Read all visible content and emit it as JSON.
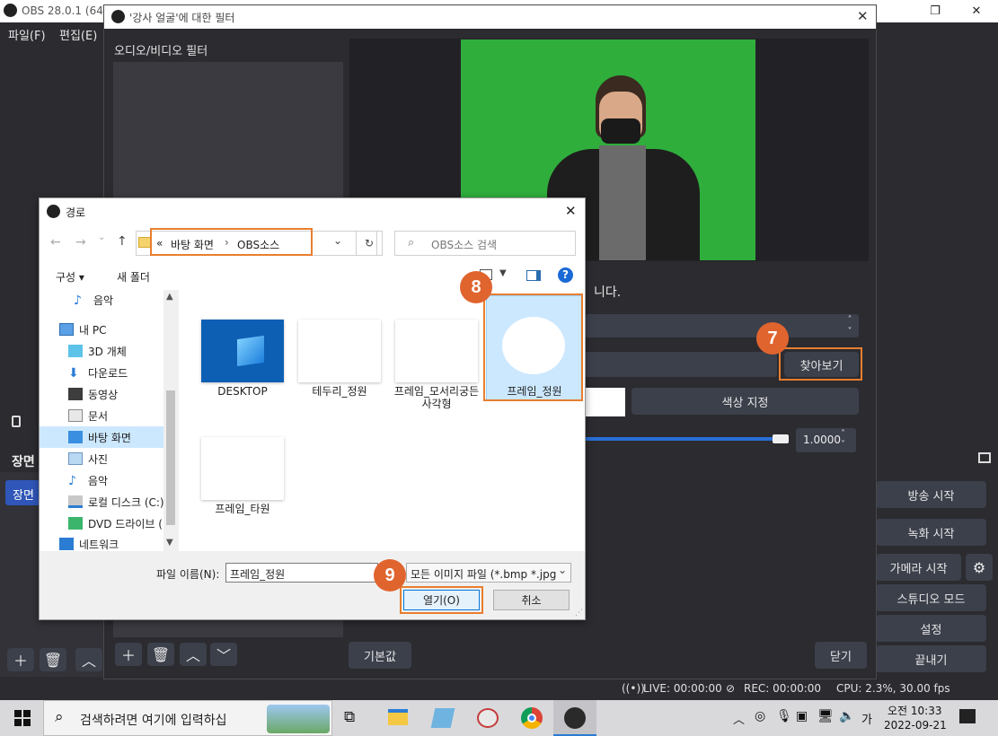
{
  "obs": {
    "title": "OBS 28.0.1 (64-",
    "menu": [
      "파일(F)",
      "편집(E)"
    ],
    "left_dock": {
      "label_partial": "장면",
      "item_partial": "장면"
    },
    "controls": [
      "방송 시작",
      "녹화 시작",
      "가메라 시작",
      "스튜디오 모드",
      "설정",
      "끝내기"
    ],
    "status": {
      "live": "LIVE: 00:00:00",
      "rec": "REC: 00:00:00",
      "cpu": "CPU: 2.3%, 30.00 fps"
    }
  },
  "filter_dialog": {
    "title": "'강사 얼굴'에 대한 필터",
    "list_header": "오디오/비디오 필터",
    "partial_text": "니다.",
    "browse_button": "찾아보기",
    "color_button": "색상 지정",
    "opacity_value": "1.0000",
    "defaults_button": "기본값",
    "close_button": "닫기"
  },
  "file_dialog": {
    "title": "경로",
    "path": {
      "prefix": "«",
      "parts": [
        "바탕 화면",
        "OBS소스"
      ]
    },
    "search_placeholder": "OBS소스 검색",
    "toolbar": {
      "organize": "구성 ▾",
      "new_folder": "새 폴더"
    },
    "nav_items": [
      "음악",
      "내 PC",
      "3D 개체",
      "다운로드",
      "동영상",
      "문서",
      "바탕 화면",
      "사진",
      "음악",
      "로컬 디스크 (C:)",
      "DVD 드라이브 (",
      "네트워크"
    ],
    "files": [
      "DESKTOP",
      "테두리_정원",
      "프레임_모서리궁든사각형",
      "프레임_정원",
      "프레임_타원"
    ],
    "filename_label": "파일 이름(N):",
    "filename_value": "프레임_정원",
    "filetype_value": "모든 이미지 파일 (*.bmp *.jpg",
    "open_button": "열기(O)",
    "cancel_button": "취소"
  },
  "badges": [
    "7",
    "8",
    "9"
  ],
  "taskbar": {
    "search_placeholder": "검색하려면 여기에 입력하십",
    "time": "오전 10:33",
    "date": "2022-09-21",
    "ime": "가"
  }
}
